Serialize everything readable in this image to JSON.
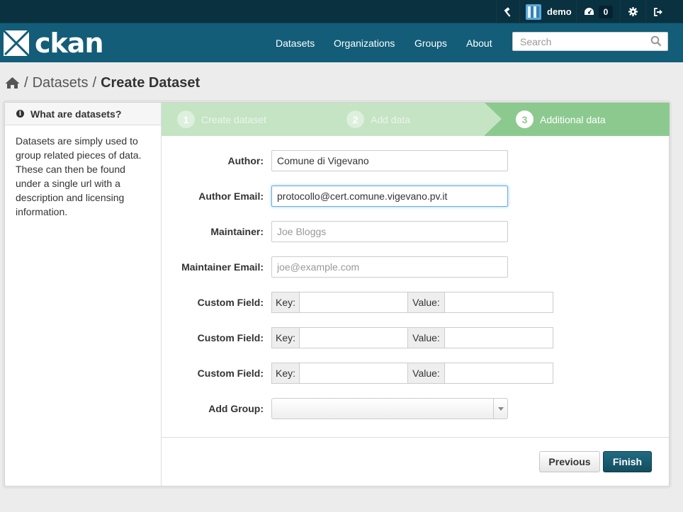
{
  "account": {
    "user_name": "demo",
    "dashboard_count": "0"
  },
  "site": {
    "logo_text": "ckan"
  },
  "nav": {
    "datasets": "Datasets",
    "organizations": "Organizations",
    "groups": "Groups",
    "about": "About"
  },
  "search": {
    "placeholder": "Search"
  },
  "breadcrumb": {
    "datasets": "Datasets",
    "current": "Create Dataset",
    "separator": "/"
  },
  "aside": {
    "heading": "What are datasets?",
    "info_glyph": "i",
    "body": "Datasets are simply used to group related pieces of data. These can then be found under a single url with a description and licensing information."
  },
  "stages": [
    {
      "num": "1",
      "label": "Create dataset",
      "state": "done"
    },
    {
      "num": "2",
      "label": "Add data",
      "state": "done"
    },
    {
      "num": "3",
      "label": "Additional data",
      "state": "active"
    }
  ],
  "form": {
    "author": {
      "label": "Author:",
      "value": "Comune di Vigevano",
      "placeholder": ""
    },
    "author_email": {
      "label": "Author Email:",
      "value": "protocollo@cert.comune.vigevano.pv.it",
      "placeholder": ""
    },
    "maintainer": {
      "label": "Maintainer:",
      "value": "",
      "placeholder": "Joe Bloggs"
    },
    "maintainer_email": {
      "label": "Maintainer Email:",
      "value": "",
      "placeholder": "joe@example.com"
    },
    "custom_fields": [
      {
        "label": "Custom Field:",
        "key_label": "Key:",
        "value_label": "Value:"
      },
      {
        "label": "Custom Field:",
        "key_label": "Key:",
        "value_label": "Value:"
      },
      {
        "label": "Custom Field:",
        "key_label": "Key:",
        "value_label": "Value:"
      }
    ],
    "add_group": {
      "label": "Add Group:",
      "selected": ""
    }
  },
  "actions": {
    "previous": "Previous",
    "finish": "Finish"
  },
  "colors": {
    "account_bar": "#09313f",
    "masthead": "#135d78",
    "stage_active": "#8cc98f",
    "stage_done": "#c4e4c4",
    "finish_button": "#1a5c70"
  },
  "icons": {
    "sysadmin": "gavel-icon",
    "dashboard": "dashboard-icon",
    "settings": "cog-icon",
    "logout": "sign-out-icon",
    "home": "home-icon",
    "search": "search-icon",
    "info": "info-icon",
    "select_caret": "caret-down-icon"
  }
}
